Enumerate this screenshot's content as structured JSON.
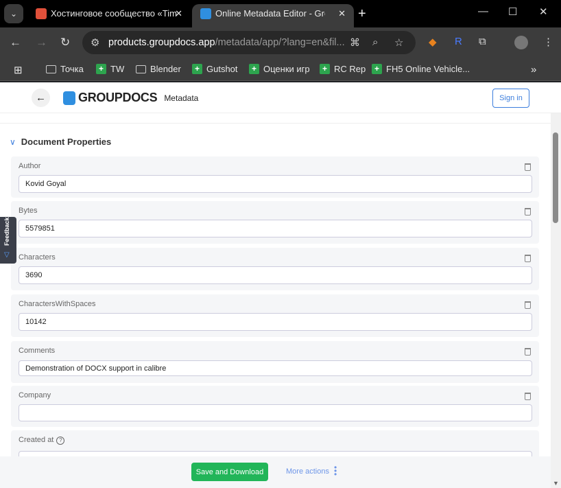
{
  "browser": {
    "tabs": [
      {
        "title": "Хостинговое сообщество «Tim",
        "favicon_color": "#e0503a"
      },
      {
        "title": "Online Metadata Editor - GroupDocs",
        "favicon_color": "#2f8fe0"
      }
    ],
    "url_host": "products.groupdocs.app",
    "url_path": "/metadata/app/?lang=en&fil...",
    "bookmarks": [
      "Точка",
      "TW",
      "Blender",
      "Gutshot",
      "Оценки игр",
      "RC Rep",
      "FH5 Online Vehicle..."
    ]
  },
  "header": {
    "brand": "GROUPDOCS",
    "product": "Metadata",
    "sign_in": "Sign in"
  },
  "section": {
    "title": "Document Properties"
  },
  "fields": [
    {
      "label": "Author",
      "value": "Kovid Goyal"
    },
    {
      "label": "Bytes",
      "value": "5579851"
    },
    {
      "label": "Characters",
      "value": "3690"
    },
    {
      "label": "CharactersWithSpaces",
      "value": "10142"
    },
    {
      "label": "Comments",
      "value": "Demonstration of DOCX support in calibre"
    },
    {
      "label": "Company",
      "value": ""
    },
    {
      "label": "Created at",
      "value": ""
    }
  ],
  "feedback": "Feedback",
  "footer": {
    "save": "Save and Download",
    "more": "More actions"
  }
}
